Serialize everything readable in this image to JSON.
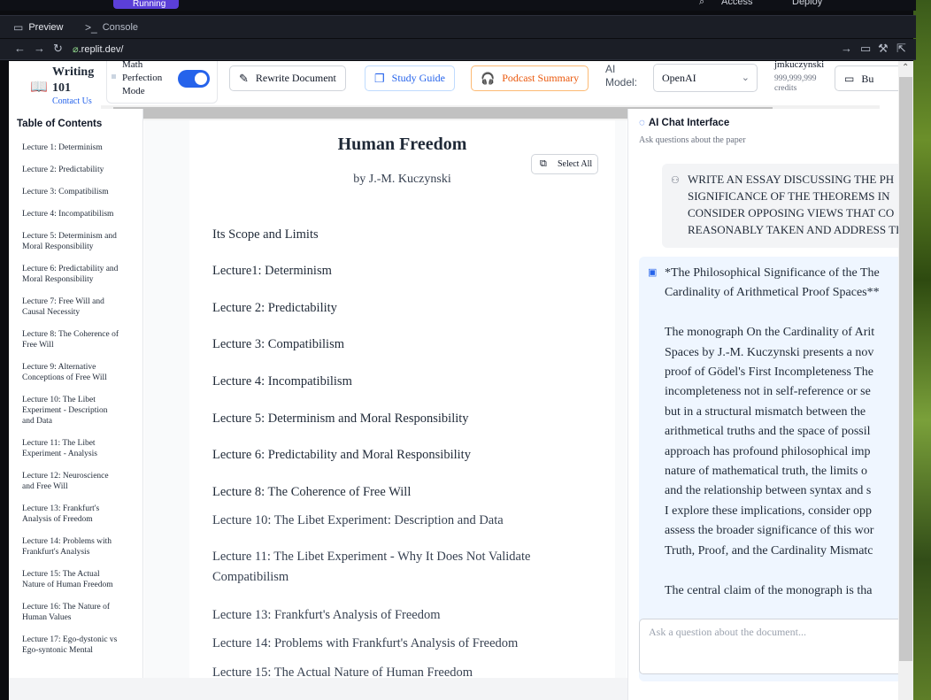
{
  "os": {
    "top_badge": "Running",
    "top_right": [
      "Access",
      "Deploy"
    ]
  },
  "tabs": [
    {
      "label": "Preview"
    },
    {
      "label": "Console"
    }
  ],
  "address": {
    "url_prefix": "⌀",
    "url": ".replit.dev/"
  },
  "header": {
    "brand": "Writing 101",
    "contact": "Contact Us",
    "math_mode_label": "Math Perfection Mode",
    "buttons": {
      "rewrite": "Rewrite Document",
      "study": "Study Guide",
      "podcast": "Podcast Summary"
    },
    "ai_model_label": "AI Model:",
    "ai_model_value": "OpenAI",
    "username": "jmkuczynski",
    "credits": "999,999,999 credits",
    "cut_button": "Bu"
  },
  "toc": {
    "title": "Table of Contents",
    "items": [
      "Lecture 1: Determinism",
      "Lecture 2: Predictability",
      "Lecture 3: Compatibilism",
      "Lecture 4: Incompatibilism",
      "Lecture 5: Determinism and Moral Responsibility",
      "Lecture 6: Predictability and Moral Responsibility",
      "Lecture 7: Free Will and Causal Necessity",
      "Lecture 8: The Coherence of Free Will",
      "Lecture 9: Alternative Conceptions of Free Will",
      "Lecture 10: The Libet Experiment - Description and Data",
      "Lecture 11: The Libet Experiment - Analysis",
      "Lecture 12: Neuroscience and Free Will",
      "Lecture 13: Frankfurt's Analysis of Freedom",
      "Lecture 14: Problems with Frankfurt's Analysis",
      "Lecture 15: The Actual Nature of Human Freedom",
      "Lecture 16: The Nature of Human Values",
      "Lecture 17: Ego-dystonic vs Ego-syntonic Mental"
    ]
  },
  "document": {
    "title": "Human Freedom",
    "author": "by J.-M. Kuczynski",
    "select_all": "Select All",
    "lines": [
      "Its Scope and Limits",
      "Lecture1: Determinism",
      "Lecture 2: Predictability",
      "Lecture 3: Compatibilism",
      "Lecture 4: Incompatibilism",
      "Lecture 5: Determinism and Moral Responsibility",
      "Lecture 6: Predictability and Moral Responsibility",
      "Lecture 8: The Coherence of Free Will",
      "Lecture 10: The Libet Experiment: Description and Data",
      "Lecture 11: The Libet Experiment - Why It Does Not Validate Compatibilism",
      "Lecture 13: Frankfurt's Analysis of Freedom",
      "Lecture 14: Problems with Frankfurt's Analysis of Freedom",
      "Lecture 15: The Actual Nature of Human Freedom"
    ]
  },
  "chat": {
    "title": "AI Chat Interface",
    "subtitle": "Ask questions about the paper",
    "user_message": "WRITE AN ESSAY DISCUSSING THE PH\nSIGNIFICANCE OF THE THEOREMS IN\nCONSIDER OPPOSING VIEWS THAT CO\nREASONABLY TAKEN AND ADDRESS TI",
    "ai_message": "*The Philosophical Significance of the The\nCardinality of Arithmetical Proof Spaces**\n\nThe monograph On the Cardinality of Arit\nSpaces by J.-M. Kuczynski presents a nov\nproof of Gödel's First Incompleteness The\nincompleteness not in self-reference or se\nbut in a structural mismatch between the\narithmetical truths and the space of possil\napproach has profound philosophical imp\nnature of mathematical truth, the limits o\nand the relationship between syntax and s\nI explore these implications, consider opp\nassess the broader significance of this wor\nTruth, Proof, and the Cardinality Mismatc\n\nThe central claim of the monograph is tha",
    "input_placeholder": "Ask a question about the document..."
  }
}
